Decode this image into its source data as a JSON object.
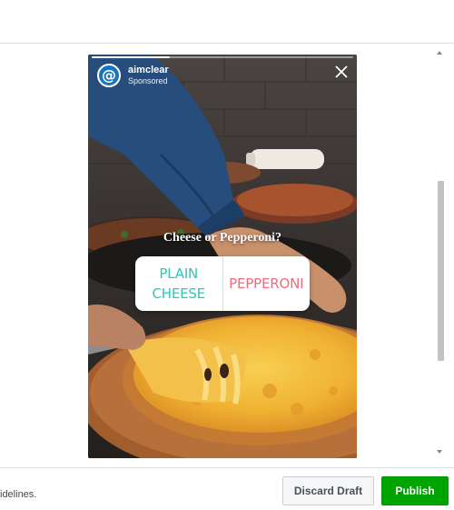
{
  "story": {
    "account_name": "aimclear",
    "account_label": "Sponsored",
    "avatar_glyph": "@",
    "progress_fraction": 0.3,
    "poll": {
      "question": "Cheese or Pepperoni?",
      "option_a": "PLAIN CHEESE",
      "option_b": "PEPPERONI"
    }
  },
  "icons": {
    "close": "close-icon",
    "avatar": "aimclear-logo",
    "scroll_up": "chevron-up-icon",
    "scroll_down": "chevron-down-icon"
  },
  "footer": {
    "guidelines_text": "idelines.",
    "discard_label": "Discard Draft",
    "publish_label": "Publish"
  },
  "colors": {
    "publish": "#00a400",
    "poll_option_a": "#2fc6b4",
    "poll_option_b": "#ec6c7a",
    "avatar": "#1b75bb"
  }
}
